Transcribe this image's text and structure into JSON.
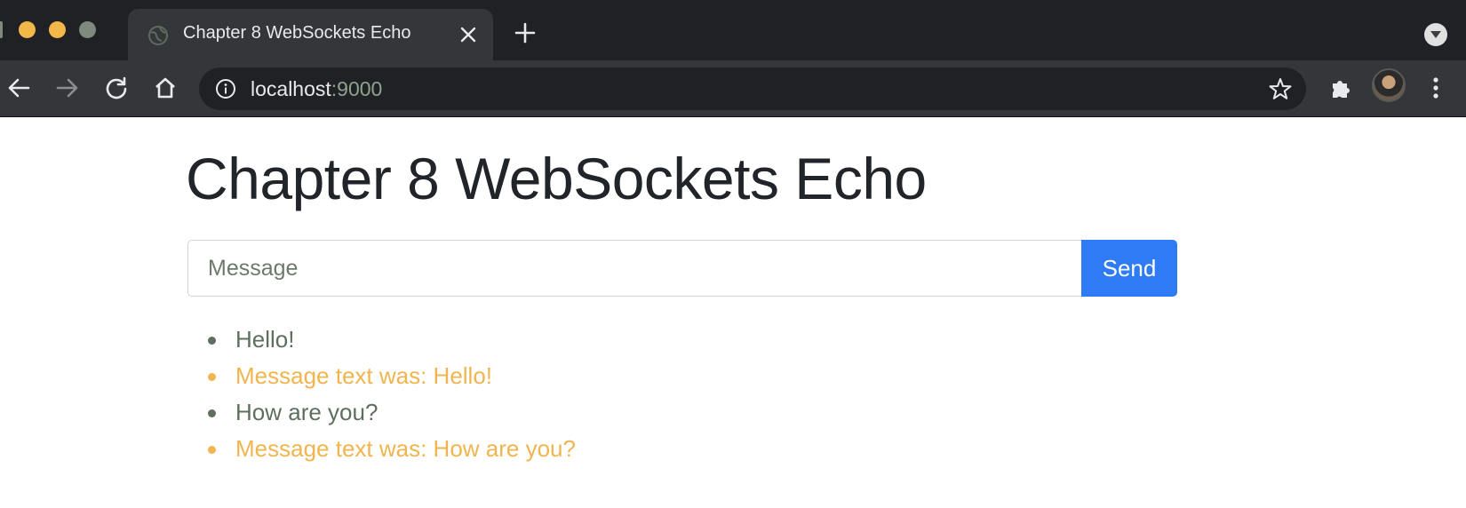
{
  "browser": {
    "tab": {
      "title": "Chapter 8 WebSockets Echo"
    },
    "address": {
      "host": "localhost",
      "port": ":9000"
    }
  },
  "page": {
    "heading": "Chapter 8 WebSockets Echo",
    "input": {
      "placeholder": "Message",
      "value": ""
    },
    "send_label": "Send",
    "messages": [
      {
        "text": "Hello!",
        "kind": "sent",
        "color": "#5f6f5f"
      },
      {
        "text": "Message text was: Hello!",
        "kind": "echo",
        "color": "#f0b54f"
      },
      {
        "text": "How are you?",
        "kind": "sent",
        "color": "#5f6f5f"
      },
      {
        "text": "Message text was: How are you?",
        "kind": "echo",
        "color": "#f0b54f"
      }
    ]
  },
  "colors": {
    "accent": "#2f7bf5",
    "echo": "#f0b54f",
    "sent": "#5f6f5f",
    "heading": "#212529"
  },
  "icons": {
    "traffic_lights": [
      "close-dot",
      "minimize-dot",
      "maximize-dot"
    ],
    "tab_favicon": "globe-icon",
    "tab_close": "close-icon",
    "new_tab": "plus-icon",
    "toolbar": [
      "back-arrow-icon",
      "forward-arrow-icon",
      "reload-icon",
      "home-icon"
    ],
    "omnibox": [
      "info-icon",
      "star-icon"
    ],
    "right": [
      "puzzle-icon",
      "avatar",
      "kebab-menu-icon",
      "chevron-down-icon"
    ]
  }
}
